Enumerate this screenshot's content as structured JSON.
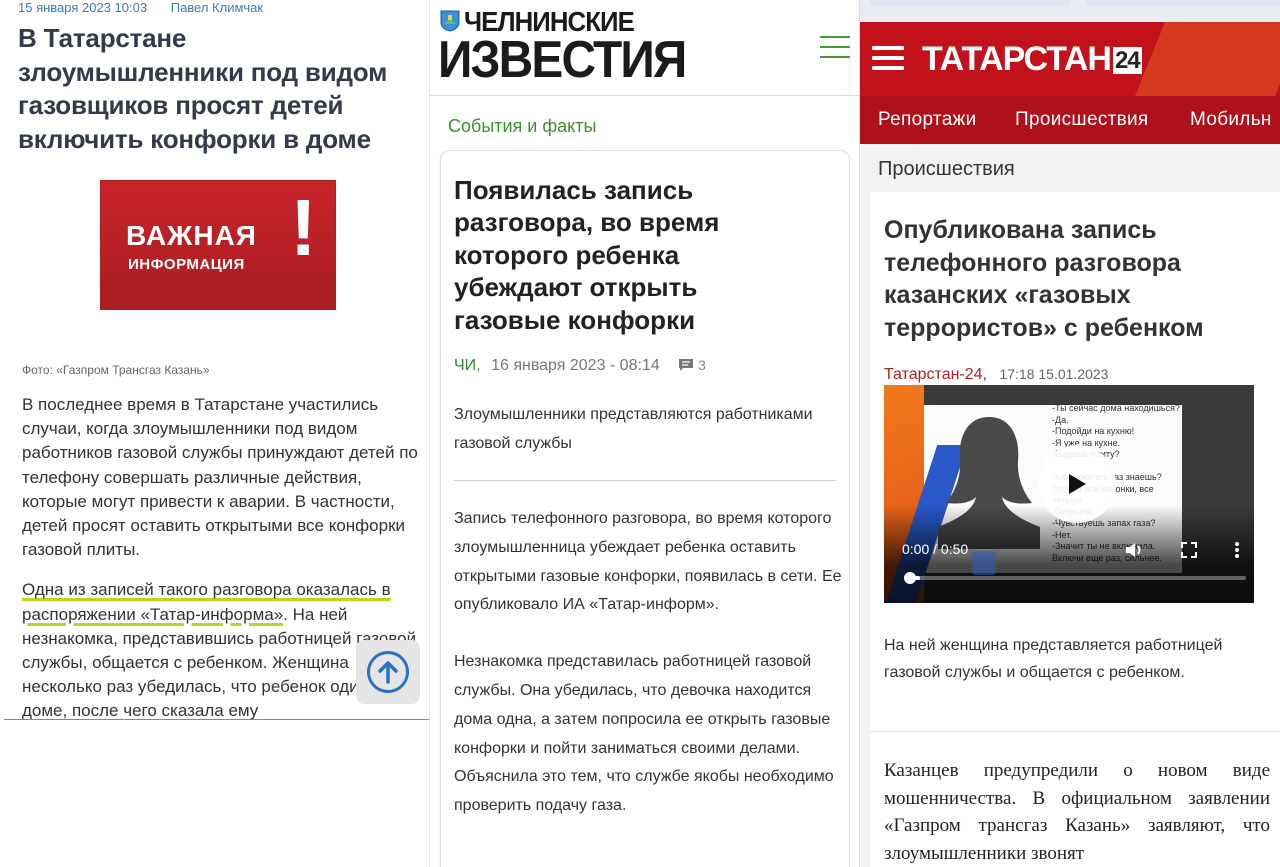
{
  "panel1": {
    "meta": {
      "date": "15 января 2023  10:03",
      "author": "Павел Климчак"
    },
    "title": "В Татарстане злоумышленники под видом газовщиков просят детей включить конфорки в доме",
    "banner": {
      "line1": "ВАЖНАЯ",
      "line2": "ИНФОРМАЦИЯ",
      "mark": "!"
    },
    "photo_caption": "Фото: «Газпром Трансгаз Казань»",
    "paragraphs": {
      "p1": "В последнее время в Татарстане участились случаи, когда злоумышленники под видом работников газовой службы принуждают детей по телефону совершать различные действия, которые могут привести к аварии. В частности, детей просят оставить открытыми все конфорки газовой плиты.",
      "p2_highlight": "Одна из записей такого разговора оказалась в распоряжении «Татар-информа»",
      "p2_rest": ". На ней незнакомка, представившись работницей газовой службы, общается с ребенком. Женщина несколько раз убедилась, что ребенок один в доме, после чего сказала ему"
    }
  },
  "panel2": {
    "logo": {
      "line1": "ЧЕЛНИНСКИЕ",
      "line2": "ИЗВЕСТИЯ"
    },
    "section": "События и факты",
    "title": "Появилась запись разговора, во время которого ребенка убеждают открыть газовые конфорки",
    "meta": {
      "source": "ЧИ",
      "sep": ",",
      "date": "16 января 2023 - 08:14",
      "comments": "3"
    },
    "lead": "Злоумышленники представляются работниками газовой службы",
    "body": {
      "p1": "Запись телефонного разговора, во время которого злоумышленница убеждает ребенка оставить открытыми газовые конфорки, появилась в сети. Ее опубликовало ИА «Татар-информ».",
      "p2": "Незнакомка представилась работницей газовой службы. Она убедилась, что девочка находится дома одна, а затем попросила ее открыть газовые конфорки и пойти заниматься своими делами. Объяснила это тем, что службе якобы необходимо проверить подачу газа."
    }
  },
  "panel3": {
    "logo": {
      "text": "ТАТАРСТАН",
      "number": "24"
    },
    "nav": [
      "Репортажи",
      "Происшествия",
      "Мобильн"
    ],
    "section": "Происшествия",
    "title": "Опубликована запись телефонного разговора казанских «газовых террористов» с ребенком",
    "meta": {
      "source": "Татарстан-24,",
      "time": "17:18 15.01.2023"
    },
    "video": {
      "transcript": [
        "-Ты сейчас дома находишься?",
        "-Да.",
        "-Подойди на кухню!",
        "-Я уже на кухне.",
        "-Видишь плиту?",
        "",
        "-Как зажигать газ знаешь? Открой все колонки, все четыре.",
        "-Открыла.",
        "-Чувствуешь запах газа?",
        "-Нет.",
        "-Значит ты не включила. Включи еще раз, сильнее."
      ],
      "time": "0:00 / 0:50",
      "progress": 0.04
    },
    "lead": "На ней женщина представляется работницей газовой службы и общается с ребенком.",
    "body": "Казанцев предупредили о новом виде мошенничества. В официальном заявлении «Газпром трансгаз Казань» заявляют, что злоумышленники звонят"
  },
  "colors": {
    "p1_link": "#3f79b8",
    "p1_highlight": "#b6d91a",
    "p2_green": "#3e8e2e",
    "p3_red": "#c1121c"
  }
}
